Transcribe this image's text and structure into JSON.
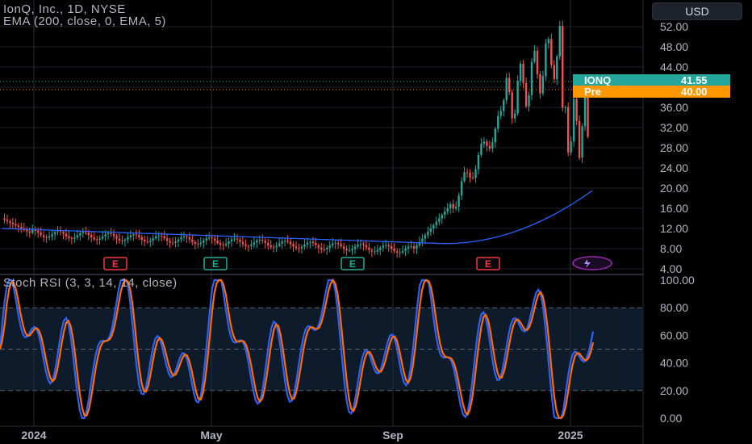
{
  "header": {
    "symbol_title": "IonQ, Inc., 1D, NYSE",
    "ema_label": "EMA (200, close, 0, EMA, 5)",
    "stoch_label": "Stoch RSI (3, 3, 14, 14, close)"
  },
  "currency_label": "USD",
  "price_axis": [
    "52.00",
    "48.00",
    "44.00",
    "40.00",
    "36.00",
    "32.00",
    "28.00",
    "24.00",
    "20.00",
    "16.00",
    "12.00",
    "8.00",
    "4.00"
  ],
  "rsi_axis": [
    "100.00",
    "80.00",
    "60.00",
    "40.00",
    "20.00",
    "0.00"
  ],
  "time_axis": [
    "2024",
    "May",
    "Sep",
    "2025"
  ],
  "last_price": {
    "name": "IONQ",
    "value": "41.55"
  },
  "pre_price": {
    "name": "Pre",
    "value": "40.00"
  },
  "events": [
    {
      "type": "earnings",
      "label": "E",
      "color": "#f23645"
    },
    {
      "type": "earnings",
      "label": "E",
      "color": "#22ab94"
    },
    {
      "type": "earnings",
      "label": "E",
      "color": "#22ab94"
    },
    {
      "type": "earnings",
      "label": "E",
      "color": "#f23645"
    },
    {
      "type": "news",
      "label": "lightning",
      "color": "#9c27b0"
    }
  ],
  "colors": {
    "up": "#26a69a",
    "down": "#ef5350",
    "ema": "#2962ff",
    "k_line": "#2962ff",
    "d_line": "#ff6d00",
    "band": "#0d1b2a"
  }
}
